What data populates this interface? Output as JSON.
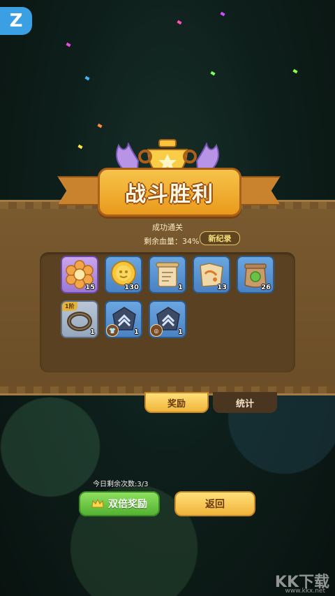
{
  "corner_logo": "Z",
  "banner": {
    "title": "战斗胜利"
  },
  "result": {
    "subtitle": "成功通关",
    "hp_label": "剩余血量：34%",
    "record_badge": "新纪录"
  },
  "rewards": [
    {
      "name": "flower-cookie",
      "qty": "15",
      "rarity": "purple"
    },
    {
      "name": "gold-coin",
      "qty": "130",
      "rarity": "blue"
    },
    {
      "name": "scroll",
      "qty": "1",
      "rarity": "blue"
    },
    {
      "name": "map-fragment",
      "qty": "13",
      "rarity": "blue"
    },
    {
      "name": "seed-bag",
      "qty": "26",
      "rarity": "blue"
    },
    {
      "name": "ring",
      "qty": "1",
      "rarity": "gray",
      "tag": "1阶"
    },
    {
      "name": "upgrade-stone-shirt",
      "qty": "1",
      "rarity": "blue"
    },
    {
      "name": "upgrade-stone-ring",
      "qty": "1",
      "rarity": "blue"
    }
  ],
  "tabs": {
    "rewards": "奖励",
    "stats": "统计"
  },
  "remaining_today": "今日剩余次数:3/3",
  "buttons": {
    "double": "双倍奖励",
    "back": "返回"
  },
  "watermark": {
    "text": "KK下载",
    "url": "www.kkx.net"
  }
}
